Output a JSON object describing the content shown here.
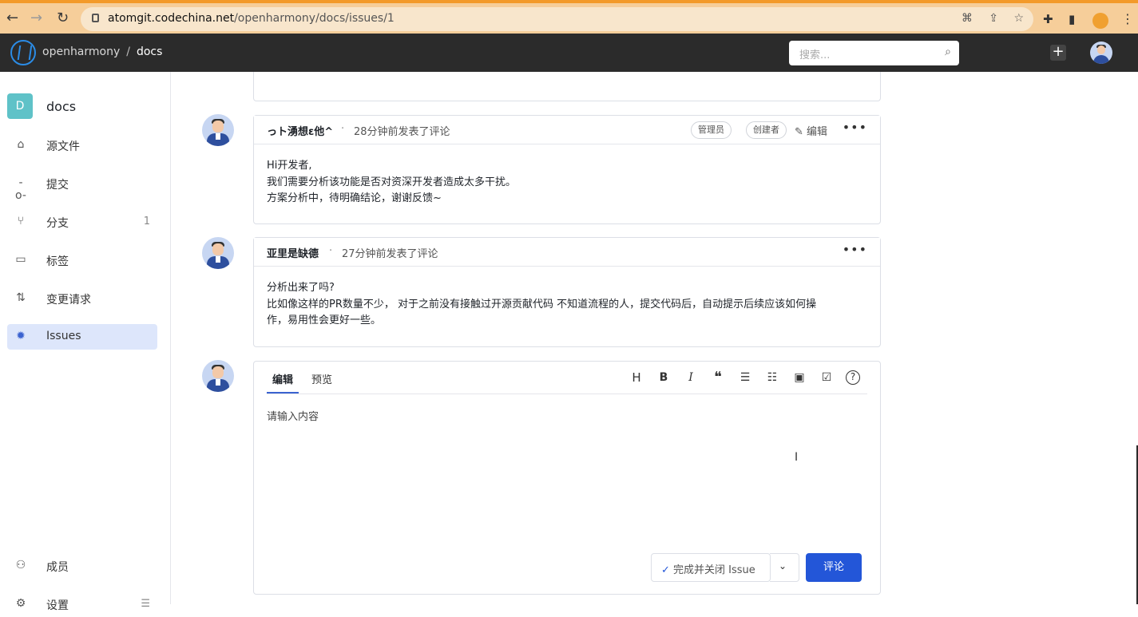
{
  "browser": {
    "back": "←",
    "forward": "→",
    "reload": "↻",
    "url_domain": "atomgit.codechina.net",
    "url_path": "/openharmony/docs/issues/1"
  },
  "header": {
    "org": "openharmony",
    "separator": "/",
    "repo": "docs",
    "search_placeholder": "搜索...",
    "plus": "+"
  },
  "sidebar": {
    "repo_initial": "D",
    "repo_name": "docs",
    "items": [
      {
        "label": "源文件",
        "icon": "code-folder-icon",
        "count": ""
      },
      {
        "label": "提交",
        "icon": "commit-icon",
        "count": ""
      },
      {
        "label": "分支",
        "icon": "branch-icon",
        "count": "1"
      },
      {
        "label": "标签",
        "icon": "tag-icon",
        "count": ""
      },
      {
        "label": "变更请求",
        "icon": "merge-request-icon",
        "count": ""
      },
      {
        "label": "Issues",
        "icon": "bug-icon",
        "count": "",
        "active": true
      },
      {
        "label": "成员",
        "icon": "user-icon",
        "count": ""
      },
      {
        "label": "设置",
        "icon": "settings-icon",
        "count": ""
      }
    ]
  },
  "comments": [
    {
      "author": "っト湧想ε他^",
      "time": "28分钟前发表了评论",
      "tags": [
        "管理员",
        "创建者"
      ],
      "edit": "编辑",
      "lines": [
        "Hi开发者,",
        "我们需要分析该功能是否对资深开发者造成太多干扰。",
        "方案分析中，待明确结论，谢谢反馈~"
      ]
    },
    {
      "author": "亚里是缺德",
      "time": "27分钟前发表了评论",
      "lines": [
        "分析出来了吗?",
        "比如像这样的PR数量不少， 对于之前没有接触过开源贡献代码 不知道流程的人，提交代码后，自动提示后续应该如何操",
        "作，易用性会更好一些。"
      ]
    }
  ],
  "editor": {
    "tab_edit": "编辑",
    "tab_preview": "预览",
    "placeholder": "请输入内容",
    "close_label": "完成并关闭 Issue",
    "submit_label": "评论",
    "tools": [
      "heading-icon",
      "bold-icon",
      "italic-icon",
      "quote-icon",
      "bullet-list-icon",
      "ordered-list-icon",
      "image-icon",
      "task-list-icon",
      "help-icon"
    ]
  }
}
